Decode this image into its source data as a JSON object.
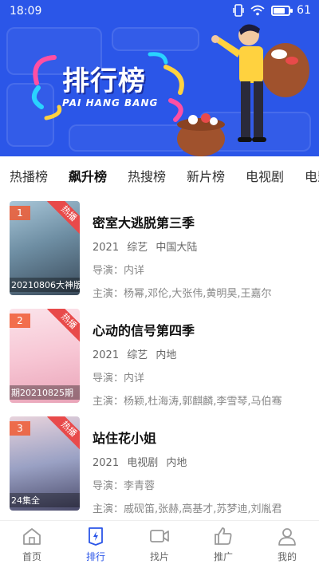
{
  "status_bar": {
    "time": "18:09",
    "battery": "61",
    "icons": [
      "vibrate-icon",
      "wifi-icon",
      "battery-icon"
    ]
  },
  "banner": {
    "logo_title": "排行榜",
    "logo_subtitle": "PAI HANG BANG",
    "bg_color": "#2b56e8"
  },
  "tabs": [
    {
      "label": "热播榜"
    },
    {
      "label": "飙升榜",
      "active": true
    },
    {
      "label": "热搜榜"
    },
    {
      "label": "新片榜"
    },
    {
      "label": "电视剧"
    },
    {
      "label": "电影"
    }
  ],
  "items": [
    {
      "rank": "1",
      "badge": "热播",
      "poster_caption": "20210806大神版",
      "title": "密室大逃脱第三季",
      "year": "2021",
      "genre": "综艺",
      "region": "中国大陆",
      "director": "导演：内详",
      "cast": "主演：杨幂,邓伦,大张伟,黄明昊,王嘉尔"
    },
    {
      "rank": "2",
      "badge": "热播",
      "poster_caption": "期20210825期",
      "title": "心动的信号第四季",
      "year": "2021",
      "genre": "综艺",
      "region": "内地",
      "director": "导演：内详",
      "cast": "主演：杨颖,杜海涛,郭麒麟,李雪琴,马伯骞"
    },
    {
      "rank": "3",
      "badge": "热播",
      "poster_caption": "24集全",
      "title": "站住花小姐",
      "year": "2021",
      "genre": "电视剧",
      "region": "内地",
      "director": "导演：李青蓉",
      "cast": "主演：戚砚笛,张赫,高基才,苏梦迪,刘胤君"
    }
  ],
  "bottom_nav": [
    {
      "label": "首页",
      "icon": "home-icon"
    },
    {
      "label": "排行",
      "icon": "ranking-icon",
      "active": true
    },
    {
      "label": "找片",
      "icon": "video-icon"
    },
    {
      "label": "推广",
      "icon": "thumbs-up-icon"
    },
    {
      "label": "我的",
      "icon": "user-icon"
    }
  ],
  "colors": {
    "accent": "#2b56e8",
    "hot_badge": "#e84a4a",
    "rank_tag": "#f05a32"
  }
}
